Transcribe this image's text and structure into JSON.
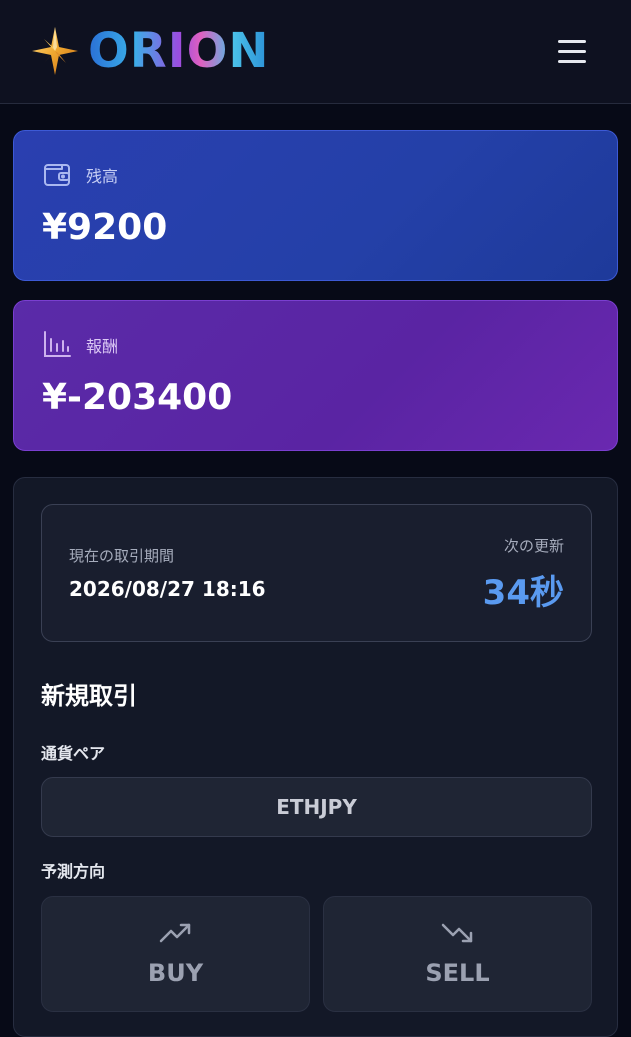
{
  "header": {
    "logo_text": "ORION",
    "logo_icon": "compass-star-icon",
    "menu_icon": "hamburger-menu-icon"
  },
  "balance": {
    "label": "残高",
    "value": "¥9200",
    "icon": "wallet-icon"
  },
  "reward": {
    "label": "報酬",
    "value": "¥-203400",
    "icon": "bar-chart-icon"
  },
  "period": {
    "label": "現在の取引期間",
    "value": "2026/08/27 18:16",
    "next_label": "次の更新",
    "next_value": "34秒"
  },
  "trade": {
    "title": "新規取引",
    "pair_label": "通貨ペア",
    "pair_value": "ETHJPY",
    "direction_label": "予測方向",
    "buy_label": "BUY",
    "sell_label": "SELL",
    "buy_icon": "trending-up-icon",
    "sell_icon": "trending-down-icon"
  },
  "colors": {
    "background": "#070a17",
    "balance_card": "#2a3fb0",
    "reward_card": "#5a2ba8",
    "accent_timer": "#5a9af0"
  }
}
